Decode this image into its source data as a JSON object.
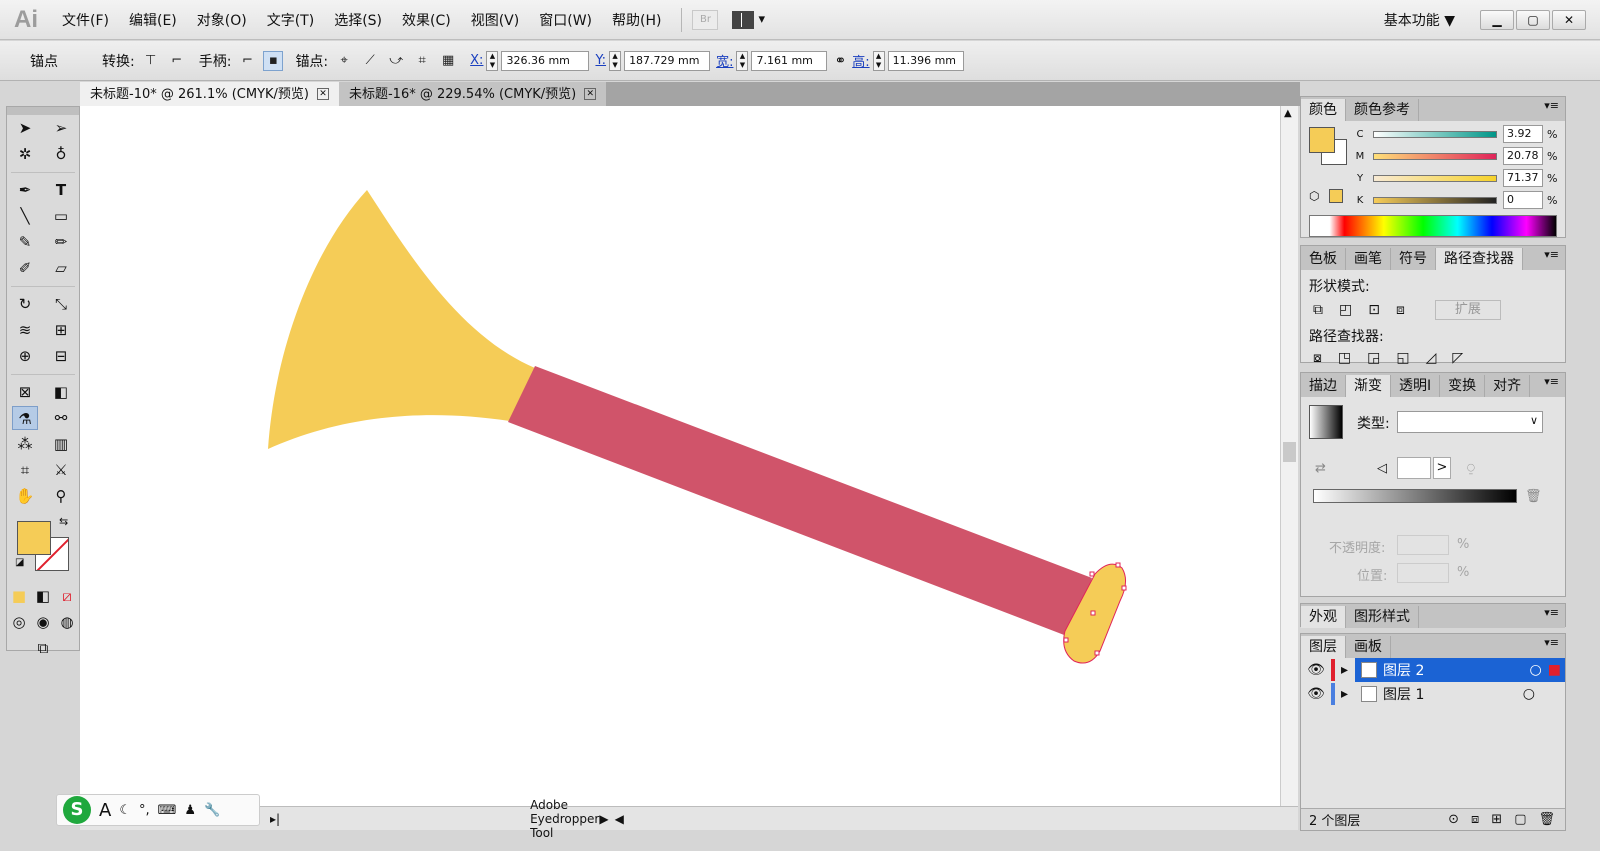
{
  "app": {
    "logo": "Ai"
  },
  "menu": [
    "文件(F)",
    "编辑(E)",
    "对象(O)",
    "文字(T)",
    "选择(S)",
    "效果(C)",
    "视图(V)",
    "窗口(W)",
    "帮助(H)"
  ],
  "bridge_label": "Br",
  "workspace": "基本功能 ▼",
  "window_buttons": [
    "▁",
    "▢",
    "✕"
  ],
  "control": {
    "anchor_label": "锚点",
    "convert_label": "转换:",
    "handle_label": "手柄:",
    "anchors_label": "锚点:",
    "x_label": "X:",
    "x_value": "326.36 mm",
    "y_label": "Y:",
    "y_value": "187.729 mm",
    "w_label": "宽:",
    "w_value": "7.161 mm",
    "h_label": "高:",
    "h_value": "11.396 mm"
  },
  "tabs": [
    {
      "title": "未标题-10* @ 261.1% (CMYK/预览)",
      "active": true
    },
    {
      "title": "未标题-16* @ 229.54% (CMYK/预览)",
      "active": false
    }
  ],
  "status": {
    "tool": "Adobe Eyedropper Tool"
  },
  "ime_label": "A",
  "color_panel": {
    "tabs": [
      "颜色",
      "颜色参考"
    ],
    "channels": [
      {
        "name": "C",
        "value": "3.92",
        "gradient": "linear-gradient(90deg,#fff,#009688)"
      },
      {
        "name": "M",
        "value": "20.78",
        "gradient": "linear-gradient(90deg,#ffe079,#e0245a)"
      },
      {
        "name": "Y",
        "value": "71.37",
        "gradient": "linear-gradient(90deg,#f8ead4,#f6d22a)"
      },
      {
        "name": "K",
        "value": "0",
        "gradient": "linear-gradient(90deg,#f7cd59,#222)"
      }
    ],
    "pct": "%",
    "fill_color": "#f5cc57"
  },
  "pathfinder_panel": {
    "tabs": [
      "色板",
      "画笔",
      "符号",
      "路径查找器"
    ],
    "shape_modes_label": "形状模式:",
    "expand_label": "扩展",
    "pathfinders_label": "路径查找器:"
  },
  "gradient_panel": {
    "tabs": [
      "描边",
      "渐变",
      "透明I",
      "变换",
      "对齐"
    ],
    "type_label": "类型:",
    "opacity_label": "不透明度:",
    "location_label": "位置:",
    "pct": "%"
  },
  "appearance_panel": {
    "tabs": [
      "外观",
      "图形样式"
    ]
  },
  "layers_panel": {
    "tabs": [
      "图层",
      "画板"
    ],
    "layers": [
      {
        "name": "图层 2",
        "selected": true
      },
      {
        "name": "图层 1",
        "selected": false
      }
    ],
    "count_label": "2 个图层"
  },
  "colors": {
    "trumpet_yellow": "#f5cc57",
    "tube_red": "#d0546a",
    "selection": "#e0245a"
  }
}
